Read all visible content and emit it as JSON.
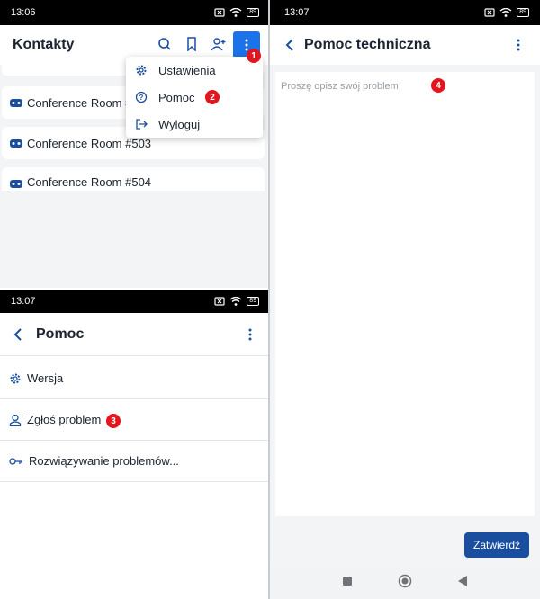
{
  "panel1": {
    "time": "13:06",
    "battery": "89",
    "title": "Kontakty",
    "contacts": [
      "Conference Room #",
      "Conference Room #503",
      "Conference Room #504"
    ],
    "menu": [
      "Ustawienia",
      "Pomoc",
      "Wyloguj"
    ],
    "badges": [
      "1",
      "2"
    ]
  },
  "panel2": {
    "time": "13:07",
    "battery": "89",
    "title": "Pomoc",
    "items": [
      "Wersja",
      "Zgłoś problem",
      "Rozwiązywanie problemów..."
    ],
    "badge": "3"
  },
  "panel3": {
    "time": "13:07",
    "battery": "89",
    "title": "Pomoc techniczna",
    "placeholder": "Proszę opisz swój problem",
    "submit_label": "Zatwierdź",
    "badge": "4"
  },
  "colors": {
    "accent": "#1a4fa0",
    "menu_button": "#1a73e8",
    "badge": "#e3161e",
    "bg_gray": "#f3f4f6"
  }
}
